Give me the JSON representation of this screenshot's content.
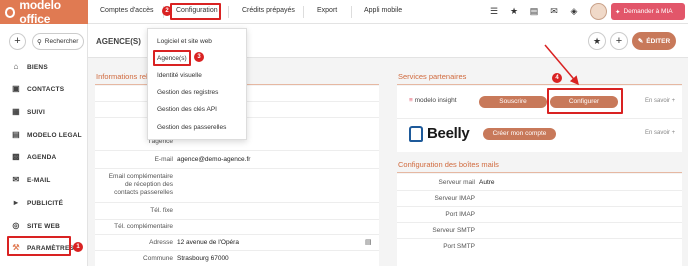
{
  "app": {
    "logo_text": "modelo office"
  },
  "topnav": {
    "items": [
      "Comptes d'accès",
      "Configuration",
      "Crédits prépayés",
      "Export",
      "Appli mobile"
    ],
    "mia_label": "Demander à MIA"
  },
  "sidebar": {
    "search_label": "Rechercher",
    "items": [
      {
        "label": "BIENS",
        "icon": "house-icon"
      },
      {
        "label": "CONTACTS",
        "icon": "address-card-icon"
      },
      {
        "label": "SUIVI",
        "icon": "clipboard-icon"
      },
      {
        "label": "MODELO LEGAL",
        "icon": "document-icon"
      },
      {
        "label": "AGENDA",
        "icon": "calendar-icon"
      },
      {
        "label": "E-MAIL",
        "icon": "envelope-icon"
      },
      {
        "label": "PUBLICITÉ",
        "icon": "megaphone-icon"
      },
      {
        "label": "SITE WEB",
        "icon": "globe-icon"
      },
      {
        "label": "PARAMÈTRES",
        "icon": "wrench-icon"
      }
    ]
  },
  "header": {
    "title": "AGENCE(S)",
    "edit_label": "ÉDITER"
  },
  "dropdown": {
    "items": [
      "Logiciel et site web",
      "Agence(s)",
      "Identité visuelle",
      "Gestion des registres",
      "Gestion des clés API",
      "Gestion des passerelles"
    ]
  },
  "info": {
    "title": "Informations rel",
    "rows": [
      {
        "label": "Nom de",
        "value": ""
      },
      {
        "label": "Res",
        "value": ""
      },
      {
        "label": "Fo\nrespo\nl'agence",
        "value": ""
      },
      {
        "label": "E-mail",
        "value": "agence@demo-agence.fr"
      },
      {
        "label": "Email complémentaire\nde réception des\ncontacts passerelles",
        "value": ""
      },
      {
        "label": "Tél. fixe",
        "value": ""
      },
      {
        "label": "Tél. complémentaire",
        "value": ""
      },
      {
        "label": "Adresse",
        "value": "12 avenue de l'Opéra"
      },
      {
        "label": "Commune",
        "value": "Strasbourg 67000"
      }
    ]
  },
  "partners": {
    "title": "Services partenaires",
    "modelo_insight": {
      "logo_prefix": "modelo",
      "logo_suffix": "insight",
      "subscribe": "Souscrire",
      "configure": "Configurer",
      "more": "En savoir +"
    },
    "beelly": {
      "logo": "Beelly",
      "create": "Créer mon compte",
      "more": "En savoir +"
    }
  },
  "mail": {
    "title": "Configuration des boîtes mails",
    "rows": [
      {
        "label": "Serveur mail",
        "value": "Autre"
      },
      {
        "label": "Serveur IMAP",
        "value": ""
      },
      {
        "label": "Port IMAP",
        "value": ""
      },
      {
        "label": "Serveur SMTP",
        "value": ""
      },
      {
        "label": "Port SMTP",
        "value": ""
      }
    ]
  },
  "annotations": {
    "badges": [
      "1",
      "2",
      "3",
      "4"
    ],
    "color": "#d92222"
  },
  "colors": {
    "brand": "#e07a52",
    "button": "#c8795a",
    "mia": "#e2566a",
    "section_title": "#d06a3e"
  }
}
